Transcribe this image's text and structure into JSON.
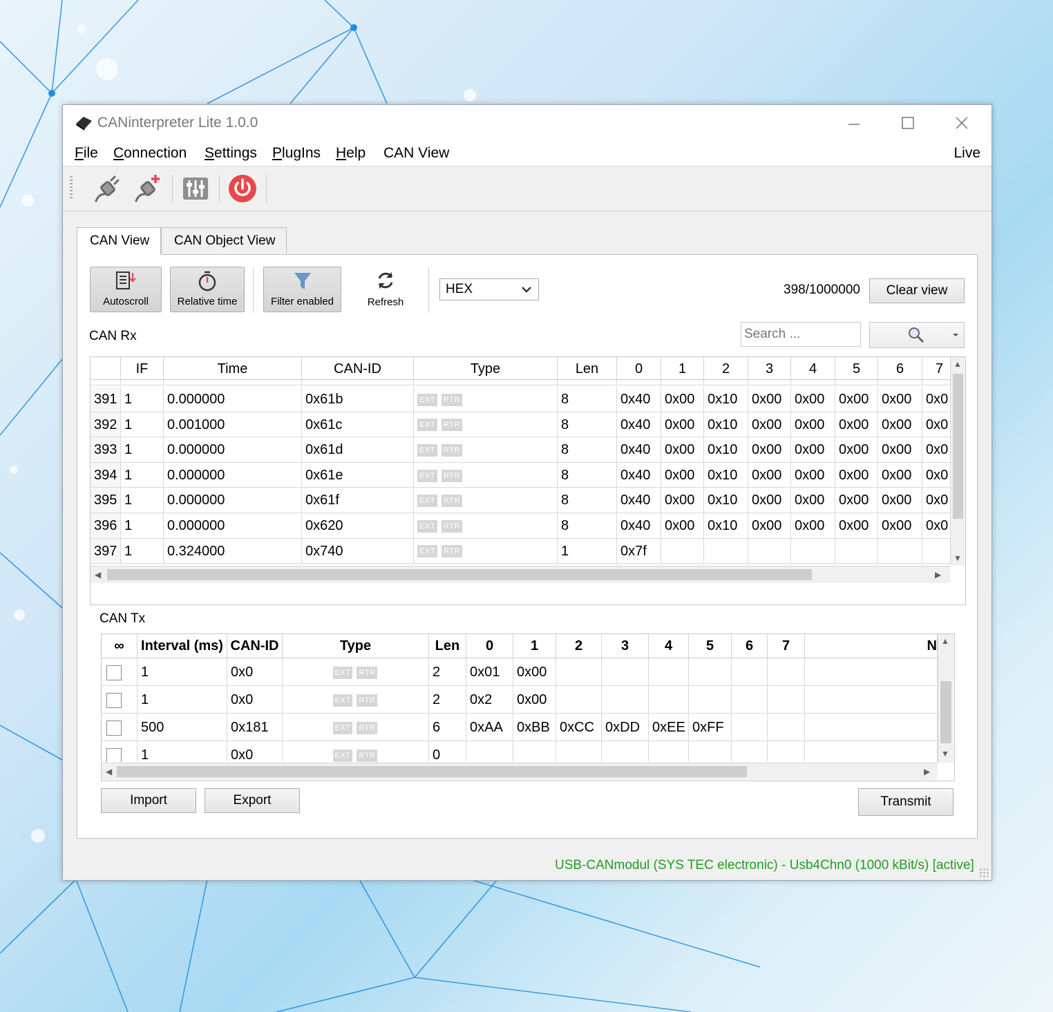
{
  "window": {
    "title": "CANinterpreter Lite 1.0.0"
  },
  "menu": [
    {
      "mnemonic": "F",
      "rest": "ile"
    },
    {
      "mnemonic": "C",
      "rest": "onnection"
    },
    {
      "mnemonic": "S",
      "rest": "ettings"
    },
    {
      "mnemonic": "P",
      "rest": "lugIns"
    },
    {
      "mnemonic": "H",
      "rest": "elp"
    },
    {
      "mnemonic": "",
      "rest": "CAN View"
    }
  ],
  "mode": "Live",
  "toolbar_icons": [
    "connect-plug-icon",
    "add-connection-plug-icon",
    "settings-sliders-icon",
    "power-icon"
  ],
  "colors": {
    "power": "#e8474b",
    "status": "#1e9e1e",
    "badge": "#d6d6d6"
  },
  "tabs": [
    {
      "label": "CAN View",
      "active": true
    },
    {
      "label": "CAN Object View",
      "active": false
    }
  ],
  "view_toolbar": {
    "autoscroll": "Autoscroll",
    "relative_time": "Relative time",
    "filter": "Filter enabled",
    "refresh": "Refresh",
    "format": "HEX",
    "count": "398/1000000",
    "clear": "Clear view"
  },
  "rx": {
    "label": "CAN Rx",
    "search_placeholder": "Search ...",
    "columns": [
      "",
      "IF",
      "Time",
      "CAN-ID",
      "Type",
      "Len",
      "0",
      "1",
      "2",
      "3",
      "4",
      "5",
      "6",
      "7"
    ],
    "rows": [
      {
        "n": "391",
        "if": "1",
        "time": "0.000000",
        "id": "0x61b",
        "len": "8",
        "d": [
          "0x40",
          "0x00",
          "0x10",
          "0x00",
          "0x00",
          "0x00",
          "0x00",
          "0x0"
        ]
      },
      {
        "n": "392",
        "if": "1",
        "time": "0.001000",
        "id": "0x61c",
        "len": "8",
        "d": [
          "0x40",
          "0x00",
          "0x10",
          "0x00",
          "0x00",
          "0x00",
          "0x00",
          "0x0"
        ]
      },
      {
        "n": "393",
        "if": "1",
        "time": "0.000000",
        "id": "0x61d",
        "len": "8",
        "d": [
          "0x40",
          "0x00",
          "0x10",
          "0x00",
          "0x00",
          "0x00",
          "0x00",
          "0x0"
        ]
      },
      {
        "n": "394",
        "if": "1",
        "time": "0.000000",
        "id": "0x61e",
        "len": "8",
        "d": [
          "0x40",
          "0x00",
          "0x10",
          "0x00",
          "0x00",
          "0x00",
          "0x00",
          "0x0"
        ]
      },
      {
        "n": "395",
        "if": "1",
        "time": "0.000000",
        "id": "0x61f",
        "len": "8",
        "d": [
          "0x40",
          "0x00",
          "0x10",
          "0x00",
          "0x00",
          "0x00",
          "0x00",
          "0x0"
        ]
      },
      {
        "n": "396",
        "if": "1",
        "time": "0.000000",
        "id": "0x620",
        "len": "8",
        "d": [
          "0x40",
          "0x00",
          "0x10",
          "0x00",
          "0x00",
          "0x00",
          "0x00",
          "0x0"
        ]
      },
      {
        "n": "397",
        "if": "1",
        "time": "0.324000",
        "id": "0x740",
        "len": "1",
        "d": [
          "0x7f",
          "",
          "",
          "",
          "",
          "",
          "",
          ""
        ]
      }
    ]
  },
  "type_badges": {
    "ext": "EXT",
    "rtr": "RTR"
  },
  "tx": {
    "label": "CAN Tx",
    "columns": [
      "∞",
      "Interval (ms)",
      "CAN-ID",
      "Type",
      "Len",
      "0",
      "1",
      "2",
      "3",
      "4",
      "5",
      "6",
      "7",
      "N"
    ],
    "rows": [
      {
        "interval": "1",
        "id": "0x0",
        "len": "2",
        "d": [
          "0x01",
          "0x00",
          "",
          "",
          "",
          "",
          "",
          ""
        ]
      },
      {
        "interval": "1",
        "id": "0x0",
        "len": "2",
        "d": [
          "0x2",
          "0x00",
          "",
          "",
          "",
          "",
          "",
          ""
        ]
      },
      {
        "interval": "500",
        "id": "0x181",
        "len": "6",
        "d": [
          "0xAA",
          "0xBB",
          "0xCC",
          "0xDD",
          "0xEE",
          "0xFF",
          "",
          ""
        ]
      },
      {
        "interval": "1",
        "id": "0x0",
        "len": "0",
        "d": [
          "",
          "",
          "",
          "",
          "",
          "",
          "",
          ""
        ]
      }
    ]
  },
  "buttons": {
    "import": "Import",
    "export": "Export",
    "transmit": "Transmit"
  },
  "status": "USB-CANmodul (SYS TEC electronic) - Usb4Chn0 (1000 kBit/s)  [active]"
}
